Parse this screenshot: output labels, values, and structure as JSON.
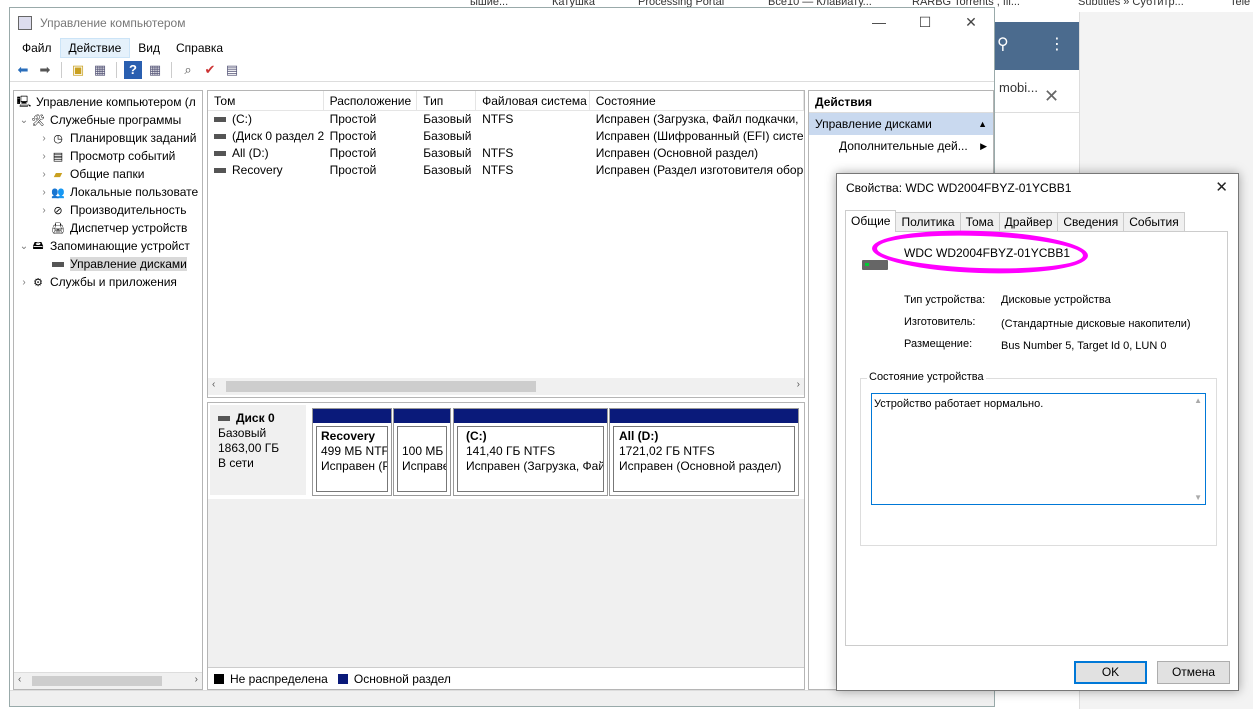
{
  "background": {
    "tabs": [
      "ышие...",
      "Катушка",
      "Processing Portal",
      "Все10 — Клавиату...",
      "RARBG Torrents , fil...",
      "Subtitles » Субтитр...",
      "Tele"
    ],
    "mobi_text": "mobi..."
  },
  "window": {
    "title": "Управление компьютером",
    "menu": [
      "Файл",
      "Действие",
      "Вид",
      "Справка"
    ]
  },
  "tree": [
    {
      "label": "Управление компьютером (л",
      "level": 0,
      "exp": "",
      "icon": "computer-management-icon"
    },
    {
      "label": "Служебные программы",
      "level": 1,
      "exp": "⌄",
      "icon": "tools-icon"
    },
    {
      "label": "Планировщик заданий",
      "level": 2,
      "exp": "›",
      "icon": "clock-icon"
    },
    {
      "label": "Просмотр событий",
      "level": 2,
      "exp": "›",
      "icon": "event-viewer-icon"
    },
    {
      "label": "Общие папки",
      "level": 2,
      "exp": "›",
      "icon": "shared-folder-icon"
    },
    {
      "label": "Локальные пользовате",
      "level": 2,
      "exp": "›",
      "icon": "users-icon"
    },
    {
      "label": "Производительность",
      "level": 2,
      "exp": "›",
      "icon": "performance-icon"
    },
    {
      "label": "Диспетчер устройств",
      "level": 2,
      "exp": "",
      "icon": "device-manager-icon"
    },
    {
      "label": "Запоминающие устройст",
      "level": 1,
      "exp": "⌄",
      "icon": "storage-icon"
    },
    {
      "label": "Управление дисками",
      "level": 2,
      "exp": "",
      "icon": "disk-icon",
      "selected": true
    },
    {
      "label": "Службы и приложения",
      "level": 1,
      "exp": "›",
      "icon": "services-icon"
    }
  ],
  "volumes": {
    "headers": [
      "Том",
      "Расположение",
      "Тип",
      "Файловая система",
      "Состояние"
    ],
    "rows": [
      [
        "(C:)",
        "Простой",
        "Базовый",
        "NTFS",
        "Исправен (Загрузка, Файл подкачки,"
      ],
      [
        "(Диск 0 раздел 2)",
        "Простой",
        "Базовый",
        "",
        "Исправен (Шифрованный (EFI) систе"
      ],
      [
        "All (D:)",
        "Простой",
        "Базовый",
        "NTFS",
        "Исправен (Основной раздел)"
      ],
      [
        "Recovery",
        "Простой",
        "Базовый",
        "NTFS",
        "Исправен (Раздел изготовителя обор"
      ]
    ]
  },
  "disk": {
    "name": "Диск 0",
    "type": "Базовый",
    "size": "1863,00 ГБ",
    "status": "В сети",
    "partitions": [
      {
        "name": "Recovery",
        "size": "499 МБ NTF",
        "status": "Исправен (Р"
      },
      {
        "name": "",
        "size": "100 МБ",
        "status": "Исправе"
      },
      {
        "name": "(C:)",
        "size": "141,40 ГБ NTFS",
        "status": "Исправен (Загрузка, Фай"
      },
      {
        "name": "All  (D:)",
        "size": "1721,02 ГБ NTFS",
        "status": "Исправен (Основной раздел)"
      }
    ]
  },
  "legend": [
    {
      "label": "Не распределена",
      "color": "#000000"
    },
    {
      "label": "Основной раздел",
      "color": "#0a1a7a"
    }
  ],
  "actions": {
    "header": "Действия",
    "section": "Управление дисками",
    "item": "Дополнительные дей..."
  },
  "dialog": {
    "title": "Свойства: WDC WD2004FBYZ-01YCBB1",
    "tabs": [
      "Общие",
      "Политика",
      "Тома",
      "Драйвер",
      "Сведения",
      "События"
    ],
    "device_name": "WDC WD2004FBYZ-01YCBB1",
    "props": [
      {
        "label": "Тип устройства:",
        "value": "Дисковые устройства"
      },
      {
        "label": "Изготовитель:",
        "value": "(Стандартные дисковые накопители)"
      },
      {
        "label": "Размещение:",
        "value": "Bus Number 5, Target Id 0, LUN 0"
      }
    ],
    "status_group": "Состояние устройства",
    "status_text": "Устройство работает нормально.",
    "ok": "OK",
    "cancel": "Отмена",
    "highlight_color": "#ff00ff"
  }
}
